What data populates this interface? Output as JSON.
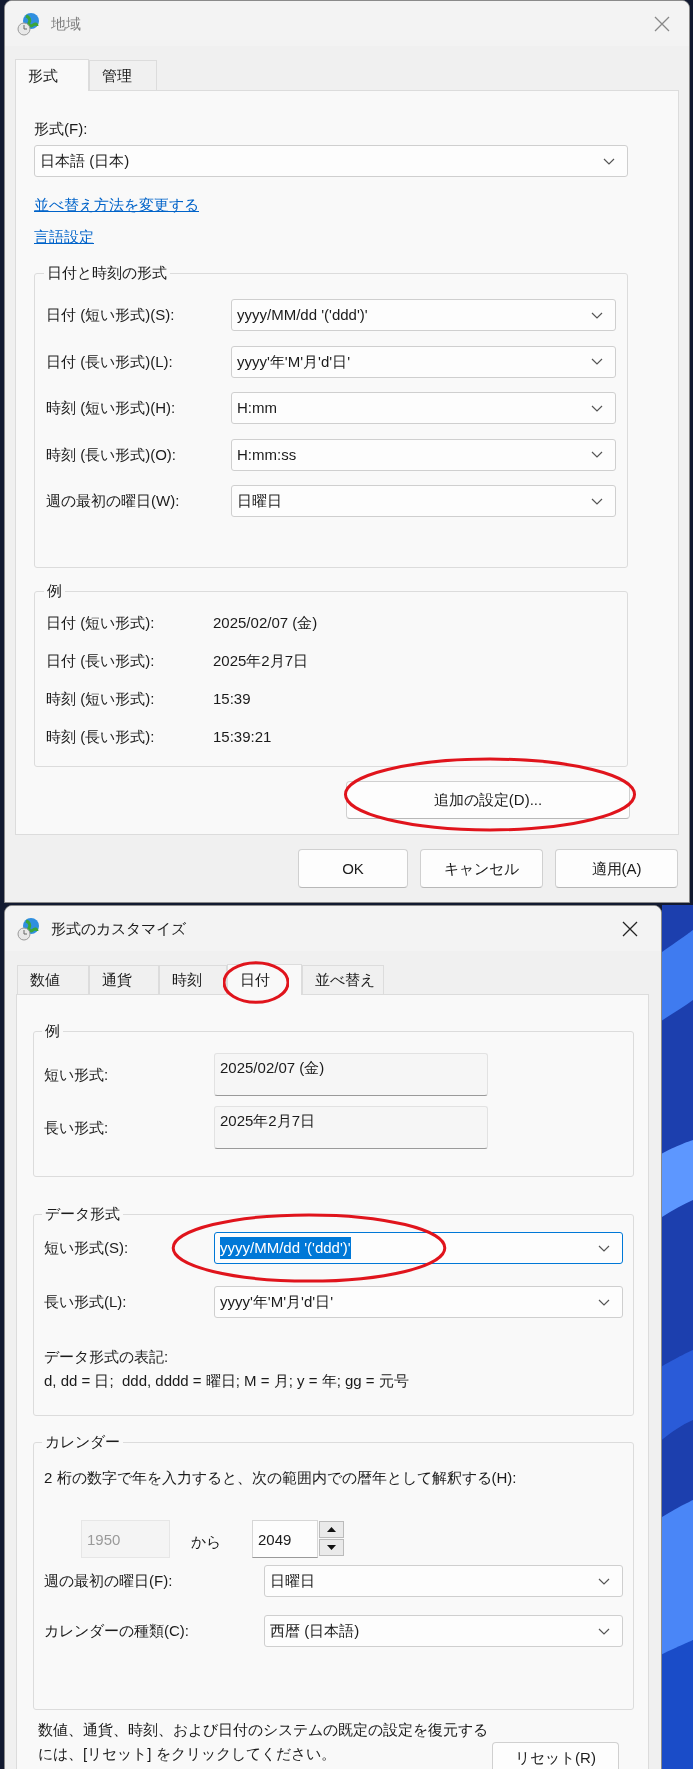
{
  "region_dialog": {
    "title": "地域",
    "tabs": [
      {
        "label": "形式",
        "selected": true
      },
      {
        "label": "管理",
        "selected": false
      }
    ],
    "format_label": "形式(F):",
    "format_value": "日本語 (日本)",
    "links": [
      "並べ替え方法を変更する",
      "言語設定"
    ],
    "date_time_formats": {
      "title": "日付と時刻の形式",
      "rows": [
        {
          "label": "日付 (短い形式)(S):",
          "value": "yyyy/MM/dd '('ddd')'"
        },
        {
          "label": "日付 (長い形式)(L):",
          "value": "yyyy'年'M'月'd'日'"
        },
        {
          "label": "時刻 (短い形式)(H):",
          "value": "H:mm"
        },
        {
          "label": "時刻 (長い形式)(O):",
          "value": "H:mm:ss"
        },
        {
          "label": "週の最初の曜日(W):",
          "value": "日曜日"
        }
      ]
    },
    "examples": {
      "title": "例",
      "rows": [
        {
          "label": "日付 (短い形式):",
          "value": "2025/02/07 (金)"
        },
        {
          "label": "日付 (長い形式):",
          "value": "2025年2月7日"
        },
        {
          "label": "時刻 (短い形式):",
          "value": "15:39"
        },
        {
          "label": "時刻 (長い形式):",
          "value": "15:39:21"
        }
      ]
    },
    "additional_settings_button": {
      "label": "追加の設定(D)...",
      "circled": true
    },
    "buttons": [
      "OK",
      "キャンセル",
      "適用(A)"
    ]
  },
  "customize_dialog": {
    "title": "形式のカスタマイズ",
    "tabs": [
      {
        "label": "数値",
        "selected": false,
        "circled": false
      },
      {
        "label": "通貨",
        "selected": false,
        "circled": false
      },
      {
        "label": "時刻",
        "selected": false,
        "circled": false
      },
      {
        "label": "日付",
        "selected": true,
        "circled": true
      },
      {
        "label": "並べ替え",
        "selected": false,
        "circled": false
      }
    ],
    "examples": {
      "title": "例",
      "rows": [
        {
          "label": "短い形式:",
          "value": "2025/02/07 (金)"
        },
        {
          "label": "長い形式:",
          "value": "2025年2月7日"
        }
      ]
    },
    "data_formats": {
      "title": "データ形式",
      "rows": [
        {
          "label": "短い形式(S):",
          "value": "yyyy/MM/dd '('ddd')'",
          "text_selected": true,
          "circled": true
        },
        {
          "label": "長い形式(L):",
          "value": "yyyy'年'M'月'd'日'",
          "text_selected": false,
          "circled": false
        }
      ],
      "notation_title": "データ形式の表記:",
      "notation": "d, dd = 日;  ddd, dddd = 曜日; M = 月; y = 年; gg = 元号"
    },
    "calendar": {
      "title": "カレンダー",
      "description": "2 桁の数字で年を入力すると、次の範囲内での暦年として解釈する(H):",
      "year_from": {
        "value": "1950",
        "disabled": true
      },
      "from_label": "から",
      "year_to": {
        "value": "2049",
        "disabled": false
      },
      "rows": [
        {
          "label": "週の最初の曜日(F):",
          "value": "日曜日"
        },
        {
          "label": "カレンダーの種類(C):",
          "value": "西暦 (日本語)"
        }
      ]
    },
    "reset_note": "数値、通貨、時刻、および日付のシステムの既定の設定を復元するには、[リセット] をクリックしてください。",
    "reset_button": "リセット(R)"
  }
}
